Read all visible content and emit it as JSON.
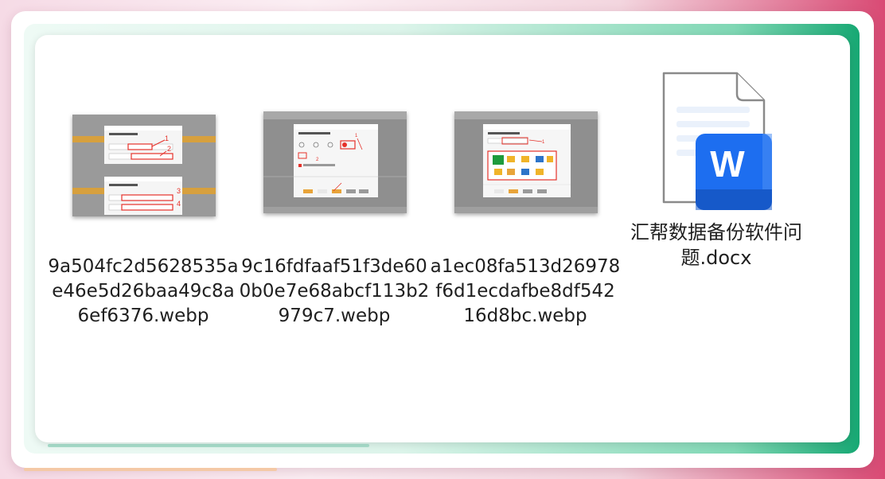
{
  "files": [
    {
      "name": "9a504fc2d5628535ae46e5d26baa49c8a6ef6376.webp",
      "type": "webp",
      "thumb": {
        "dialog_title": "设置数据备份任务",
        "section_title": "1、设置备份文件夹",
        "field1_label": "备份源路径",
        "field2_label": "备份目标路径",
        "markers": [
          "1",
          "2",
          "3",
          "4"
        ]
      }
    },
    {
      "name": "9c16fdfaaf51f3de600b0e7e68abcf113b2979c7.webp",
      "type": "webp",
      "thumb": {
        "dialog_title": "设置数据备份任务",
        "section_title": "2、设置数据备份方式",
        "markers": [
          "1",
          "2"
        ]
      }
    },
    {
      "name": "a1ec08fa513d26978f6d1ecdafbe8df54216d8bc.webp",
      "type": "webp",
      "thumb": {
        "dialog_title": "设置数据备份任务",
        "section_title": "3、设置备份频率",
        "markers": [
          "1"
        ]
      }
    },
    {
      "name": "汇帮数据备份软件问题.docx",
      "type": "docx",
      "icon": "word-document-icon",
      "icon_letter": "W"
    }
  ],
  "colors": {
    "word_blue": "#1d6ef0",
    "word_blue_dark": "#1659c9",
    "annotation_red": "#e5312a",
    "thumb_gray": "#8e8e8e",
    "thumb_orange": "#e8a43a"
  }
}
